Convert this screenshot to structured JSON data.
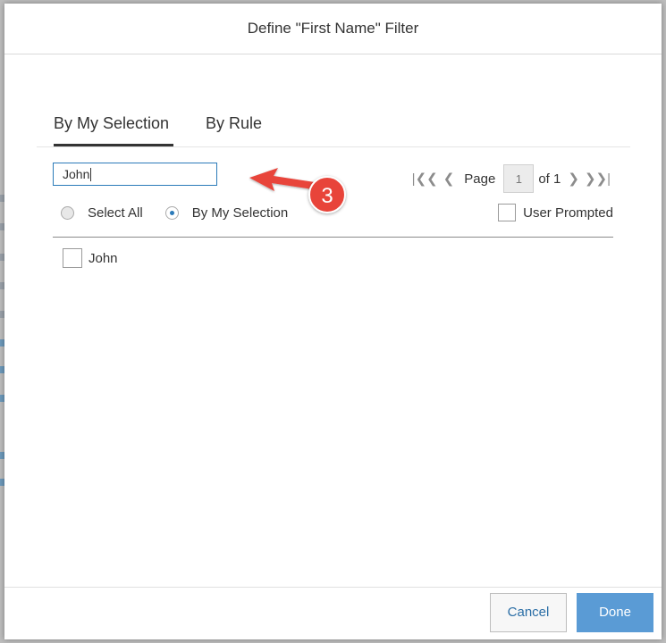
{
  "dialog": {
    "title": "Define \"First Name\" Filter",
    "tabs": [
      {
        "label": "By My Selection",
        "active": true
      },
      {
        "label": "By Rule",
        "active": false
      }
    ],
    "search": {
      "value": "John"
    },
    "pager": {
      "page_label": "Page",
      "page_value": "1",
      "of_label": "of 1"
    },
    "selection_mode": {
      "options": [
        {
          "label": "Select All",
          "selected": false
        },
        {
          "label": "By My Selection",
          "selected": true
        }
      ]
    },
    "user_prompted": {
      "label": "User Prompted",
      "checked": false
    },
    "items": [
      {
        "label": "John",
        "checked": false
      }
    ],
    "footer": {
      "cancel_label": "Cancel",
      "done_label": "Done"
    }
  },
  "annotation": {
    "step_number": "3",
    "color": "#e8443a"
  },
  "colors": {
    "accent": "#2b7bb9",
    "done_button": "#5a9bd5",
    "overlay": "#bdbdbd"
  }
}
